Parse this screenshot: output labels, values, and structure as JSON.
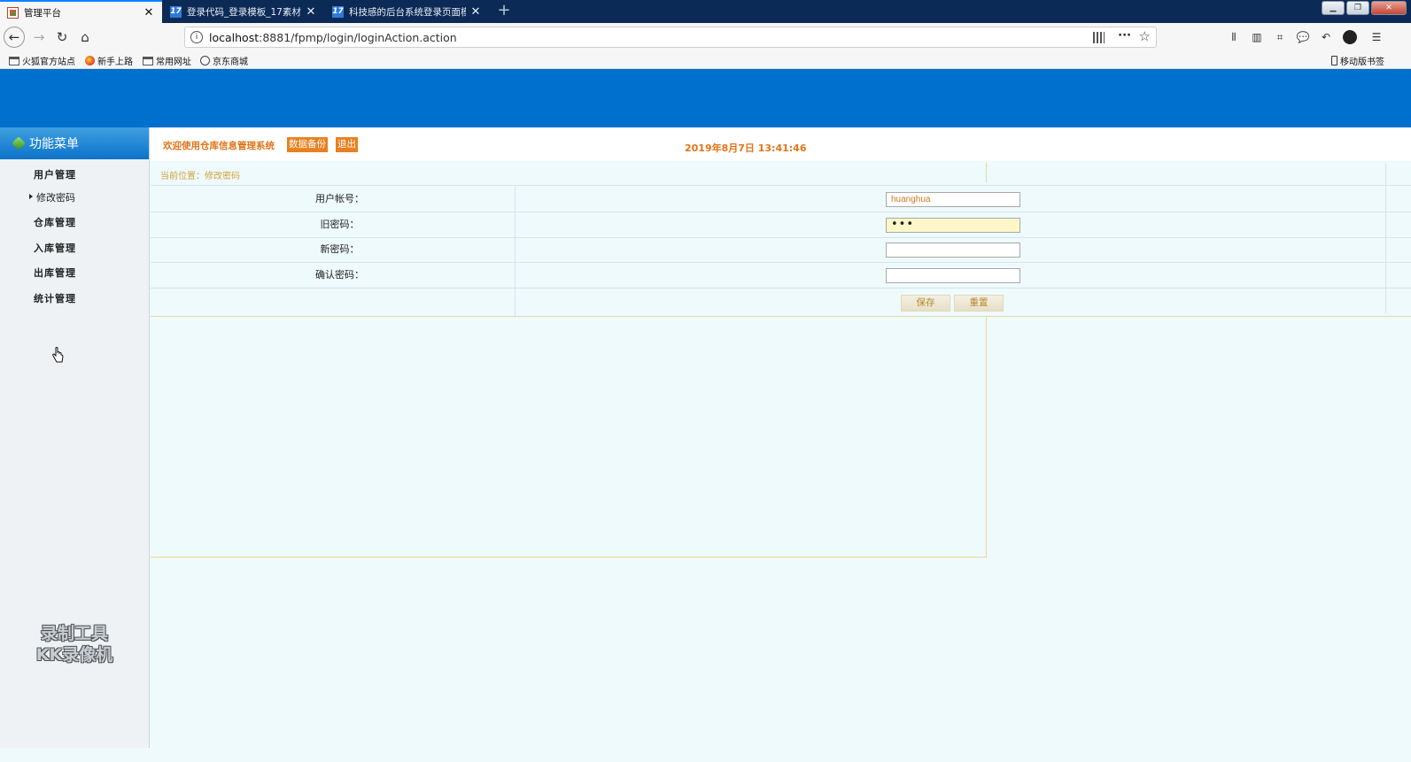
{
  "browser": {
    "tabs": [
      {
        "title": "管理平台",
        "active": true
      },
      {
        "title": "登录代码_登录模板_17素材网",
        "active": false
      },
      {
        "title": "科技感的后台系统登录页面模板",
        "active": false
      }
    ],
    "url_host": "localhost",
    "url_rest": ":8881/fpmp/login/loginAction.action",
    "bookmarks": [
      "火狐官方站点",
      "新手上路",
      "常用网址",
      "京东商城"
    ],
    "mobile_bookmarks": "移动版书签"
  },
  "sidebar": {
    "title": "功能菜单",
    "items": [
      "用户管理",
      "修改密码",
      "仓库管理",
      "入库管理",
      "出库管理",
      "统计管理"
    ],
    "current_index": 1,
    "watermark_line1": "录制工具",
    "watermark_line2": "KK录像机"
  },
  "header": {
    "welcome": "欢迎使用仓库信息管理系统",
    "backup_label": "数据备份",
    "logout_label": "退出",
    "datetime": "2019年8月7日 13:41:46"
  },
  "breadcrumb": "当前位置：修改密码",
  "form": {
    "username_label": "用户帐号：",
    "username_value": "huanghua",
    "old_password_label": "旧密码：",
    "old_password_value": "•••",
    "new_password_label": "新密码：",
    "new_password_value": "",
    "confirm_password_label": "确认密码：",
    "confirm_password_value": "",
    "save_label": "保存",
    "reset_label": "重置"
  },
  "colors": {
    "banner": "#0070cf",
    "accent_orange": "#e8801f",
    "page_bg": "#eefafc"
  }
}
